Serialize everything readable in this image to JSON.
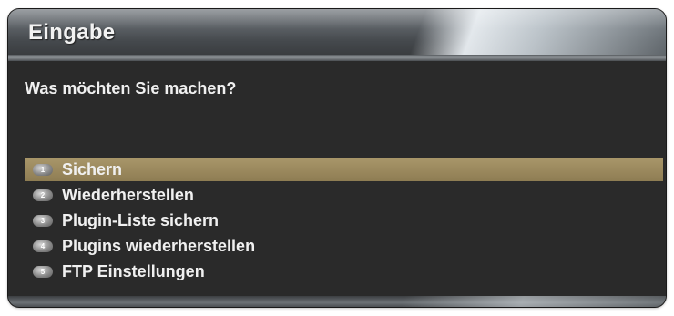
{
  "dialog": {
    "title": "Eingabe",
    "prompt": "Was möchten Sie machen?",
    "items": [
      {
        "number": "1",
        "label": "Sichern",
        "selected": true
      },
      {
        "number": "2",
        "label": "Wiederherstellen",
        "selected": false
      },
      {
        "number": "3",
        "label": "Plugin-Liste sichern",
        "selected": false
      },
      {
        "number": "4",
        "label": "Plugins wiederherstellen",
        "selected": false
      },
      {
        "number": "5",
        "label": "FTP Einstellungen",
        "selected": false
      }
    ]
  },
  "colors": {
    "selection": "#9c8a5e",
    "background": "#2a2a2a",
    "text": "#f0f0f0"
  }
}
